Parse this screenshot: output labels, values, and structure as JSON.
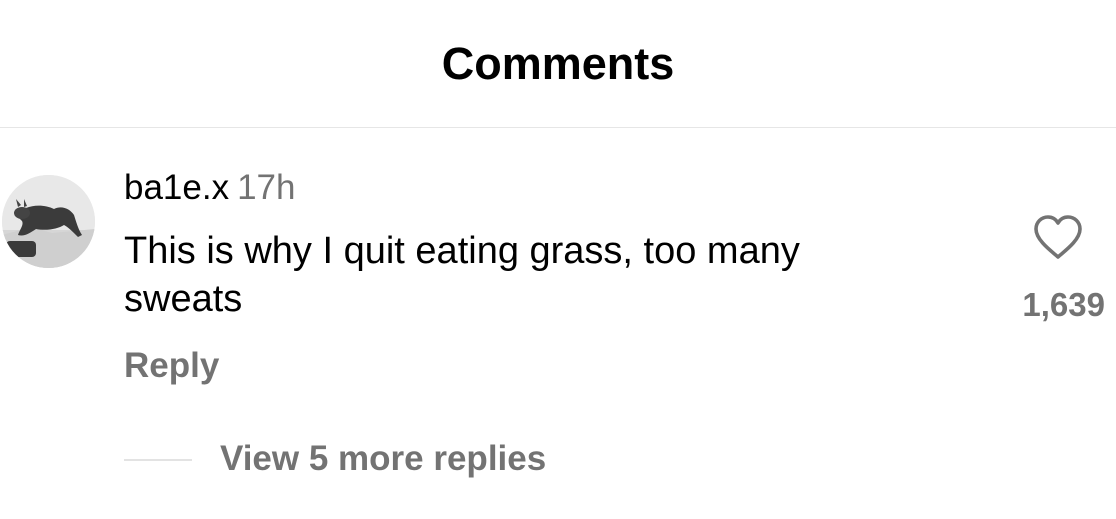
{
  "header": {
    "title": "Comments"
  },
  "comment": {
    "username": "ba1e.x",
    "time": "17h",
    "text": "This is why I quit eating grass, too many sweats",
    "reply_label": "Reply",
    "like_count": "1,639",
    "like_icon": "heart-outline-icon",
    "view_more_replies_label": "View 5 more replies"
  },
  "colors": {
    "primary_text": "#000000",
    "secondary_text": "#737373",
    "divider": "#e6e6e6"
  }
}
